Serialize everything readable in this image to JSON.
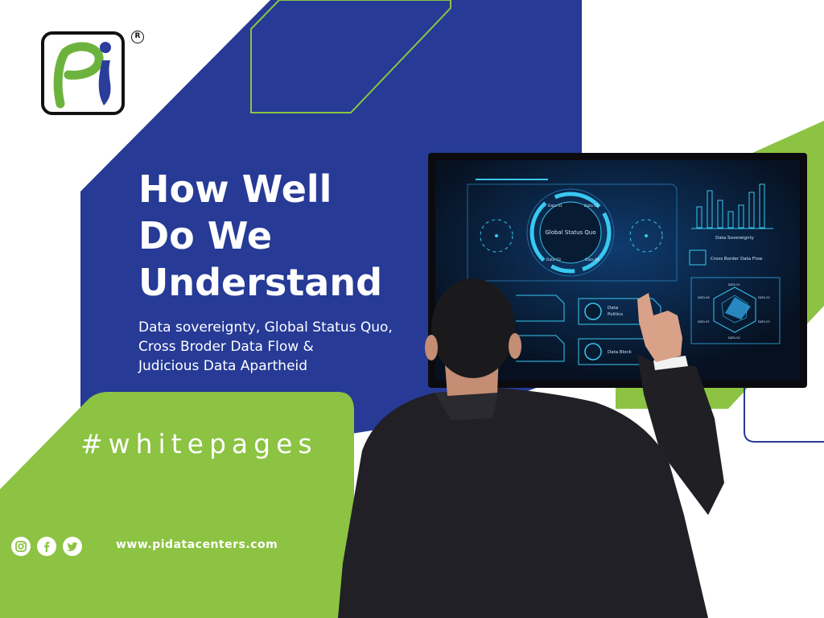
{
  "logo": {
    "letters": "Pi",
    "registered": "R"
  },
  "headline": {
    "line1": "How Well",
    "line2": "Do We",
    "line3": "Understand"
  },
  "subtitle": {
    "line1": "Data sovereignty, Global Status Quo,",
    "line2": "Cross Broder Data Flow &",
    "line3": "Judicious Data Apartheid"
  },
  "hashtag": "#whitepages",
  "website": "www.pidatacenters.com",
  "social": [
    {
      "name": "instagram-icon"
    },
    {
      "name": "facebook-icon"
    },
    {
      "name": "twitter-icon"
    }
  ],
  "screen": {
    "center_label": "Global Status Quo",
    "ring_label_1": "Data 01",
    "ring_label_2": "Data 02",
    "ring_label_3": "Data 03",
    "ring_label_4": "Data 04",
    "bars_title": "Data Sovereignty",
    "cross_border": "Cross Border Data Flow",
    "data_politics_1": "Data",
    "data_politics_2": "Politics",
    "data_block": "Data Block",
    "radar_labels": [
      "DATA 01",
      "DATA 02",
      "DATA 03",
      "DATA 04",
      "DATA 05",
      "DATA 06"
    ]
  },
  "colors": {
    "navy": "#263a96",
    "green": "#8cc342",
    "white": "#ffffff",
    "screen_cyan": "#38c8f0"
  }
}
